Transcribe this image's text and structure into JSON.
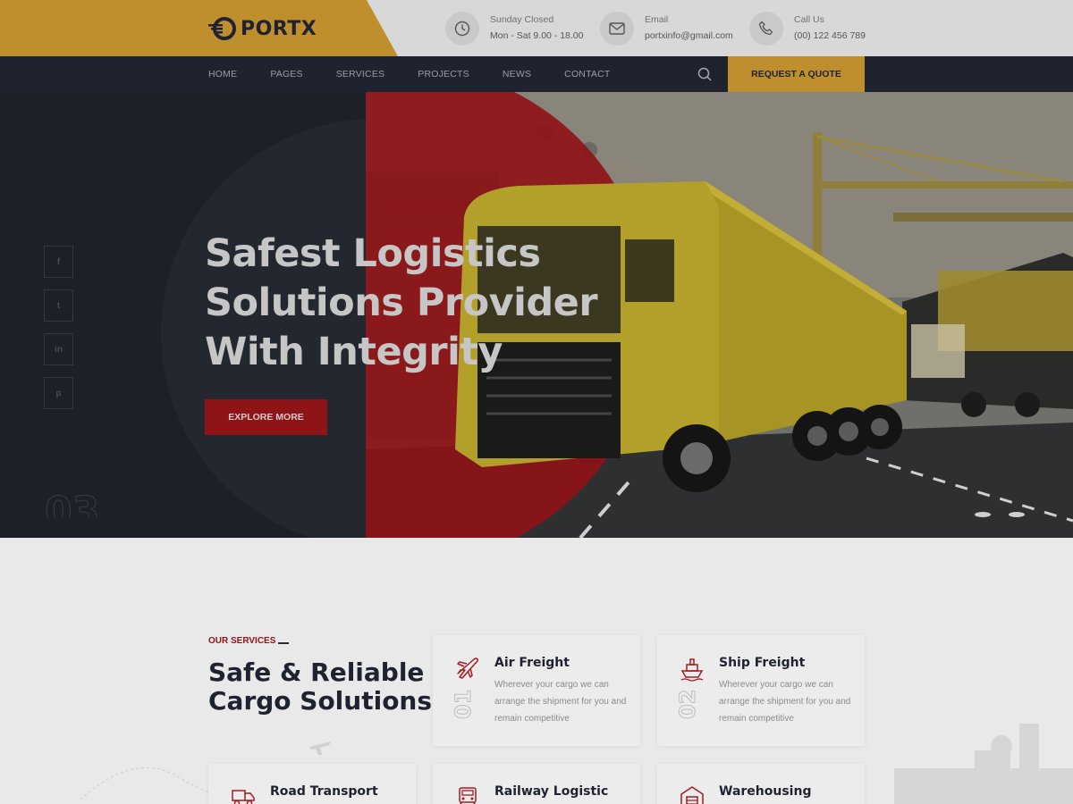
{
  "brand": {
    "name": "PORTX"
  },
  "contacts": [
    {
      "icon": "clock-icon",
      "label": "Sunday Closed",
      "value": "Mon - Sat 9.00 - 18.00"
    },
    {
      "icon": "envelope-icon",
      "label": "Email",
      "value": "portxinfo@gmail.com"
    },
    {
      "icon": "phone-icon",
      "label": "Call Us",
      "value": "(00) 122 456 789"
    }
  ],
  "nav": {
    "items": [
      "HOME",
      "PAGES",
      "SERVICES",
      "PROJECTS",
      "NEWS",
      "CONTACT"
    ],
    "quote_label": "REQUEST A QUOTE"
  },
  "hero": {
    "title_lines": [
      "Safest Logistics",
      "Solutions Provider",
      "With Integrity"
    ],
    "button_label": "EXPLORE MORE",
    "slide_number": "03",
    "social": [
      {
        "icon": "facebook-icon",
        "glyph": "f"
      },
      {
        "icon": "twitter-icon",
        "glyph": "t"
      },
      {
        "icon": "linkedin-icon",
        "glyph": "in"
      },
      {
        "icon": "pinterest-icon",
        "glyph": "p"
      }
    ]
  },
  "services": {
    "tag": "OUR SERVICES",
    "heading_lines": [
      "Safe & Reliable",
      "Cargo Solutions"
    ],
    "cards": [
      {
        "icon": "airplane-icon",
        "title": "Air Freight",
        "desc": "Wherever your cargo we can arrange the shipment for you and remain competitive",
        "num": "01"
      },
      {
        "icon": "ship-icon",
        "title": "Ship Freight",
        "desc": "Wherever your cargo we can arrange the shipment for you and remain competitive",
        "num": "02"
      },
      {
        "icon": "truck-icon",
        "title": "Road Transport"
      },
      {
        "icon": "train-icon",
        "title": "Railway Logistic"
      },
      {
        "icon": "warehouse-icon",
        "title": "Warehousing"
      }
    ]
  },
  "colors": {
    "accent_gold": "#bf8e2d",
    "accent_red": "#8e1418",
    "dark": "#1f2330"
  }
}
